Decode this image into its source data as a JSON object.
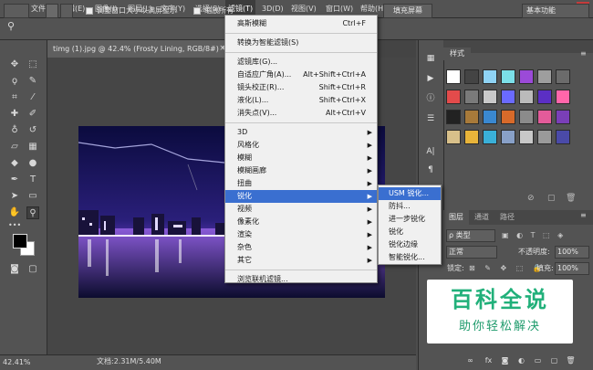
{
  "app": {
    "logo": "Ps"
  },
  "menubar": {
    "items": [
      "文件(F)",
      "编辑(E)",
      "图像(I)",
      "图层(L)",
      "文字(Y)",
      "选择(S)",
      "滤镜(T)",
      "3D(D)",
      "视图(V)",
      "窗口(W)",
      "帮助(H)"
    ],
    "active": "滤镜(T)"
  },
  "window_controls": {
    "minimize": "–",
    "maximize": "☐",
    "close": "✕"
  },
  "options_bar": {
    "checkbox1_label": "调整窗口大小以满屏显示",
    "checkbox2_label": "缩放所有",
    "fill_screen_button": "填充屏幕",
    "workspace_select": "基本功能"
  },
  "document": {
    "tab_title": "timg (1).jpg @ 42.4% (Frosty Lining, RGB/8#) *",
    "tab_close": "×",
    "zoom_status": "42.41%",
    "doc_info": "文档:2.31M/5.40M"
  },
  "filter_menu": {
    "items": [
      {
        "label": "高斯模糊",
        "shortcut": "Ctrl+F"
      },
      {
        "sep": true
      },
      {
        "label": "转换为智能滤镜(S)"
      },
      {
        "sep": true
      },
      {
        "label": "滤镜库(G)..."
      },
      {
        "label": "自适应广角(A)...",
        "shortcut": "Alt+Shift+Ctrl+A"
      },
      {
        "label": "镜头校正(R)...",
        "shortcut": "Shift+Ctrl+R"
      },
      {
        "label": "液化(L)...",
        "shortcut": "Shift+Ctrl+X"
      },
      {
        "label": "消失点(V)...",
        "shortcut": "Alt+Ctrl+V"
      },
      {
        "sep": true
      },
      {
        "label": "3D",
        "submenu": true
      },
      {
        "label": "风格化",
        "submenu": true
      },
      {
        "label": "模糊",
        "submenu": true
      },
      {
        "label": "模糊画廊",
        "submenu": true
      },
      {
        "label": "扭曲",
        "submenu": true
      },
      {
        "label": "锐化",
        "submenu": true,
        "highlight": true
      },
      {
        "label": "视频",
        "submenu": true
      },
      {
        "label": "像素化",
        "submenu": true
      },
      {
        "label": "渲染",
        "submenu": true
      },
      {
        "label": "杂色",
        "submenu": true
      },
      {
        "label": "其它",
        "submenu": true
      },
      {
        "sep": true
      },
      {
        "label": "浏览联机滤镜..."
      }
    ],
    "arrow": "▶"
  },
  "sharpen_submenu": {
    "items": [
      "USM 锐化...",
      "防抖...",
      "进一步锐化",
      "锐化",
      "锐化边缘",
      "智能锐化..."
    ],
    "highlight_index": 0
  },
  "styles_panel": {
    "tab": "样式"
  },
  "layers_panel": {
    "tabs": [
      "图层",
      "通道",
      "路径"
    ],
    "filter_kind": "ρ 类型",
    "blend_mode": "正常",
    "opacity_label": "不透明度:",
    "opacity_value": "100%",
    "lock_label": "锁定:",
    "fill_label": "填充:",
    "fill_value": "100%"
  },
  "watermark": {
    "title": "百科全说",
    "subtitle": "助你轻松解决"
  },
  "colors": {
    "accent": "#3a6fd0",
    "watermark_green": "#21b07a"
  }
}
